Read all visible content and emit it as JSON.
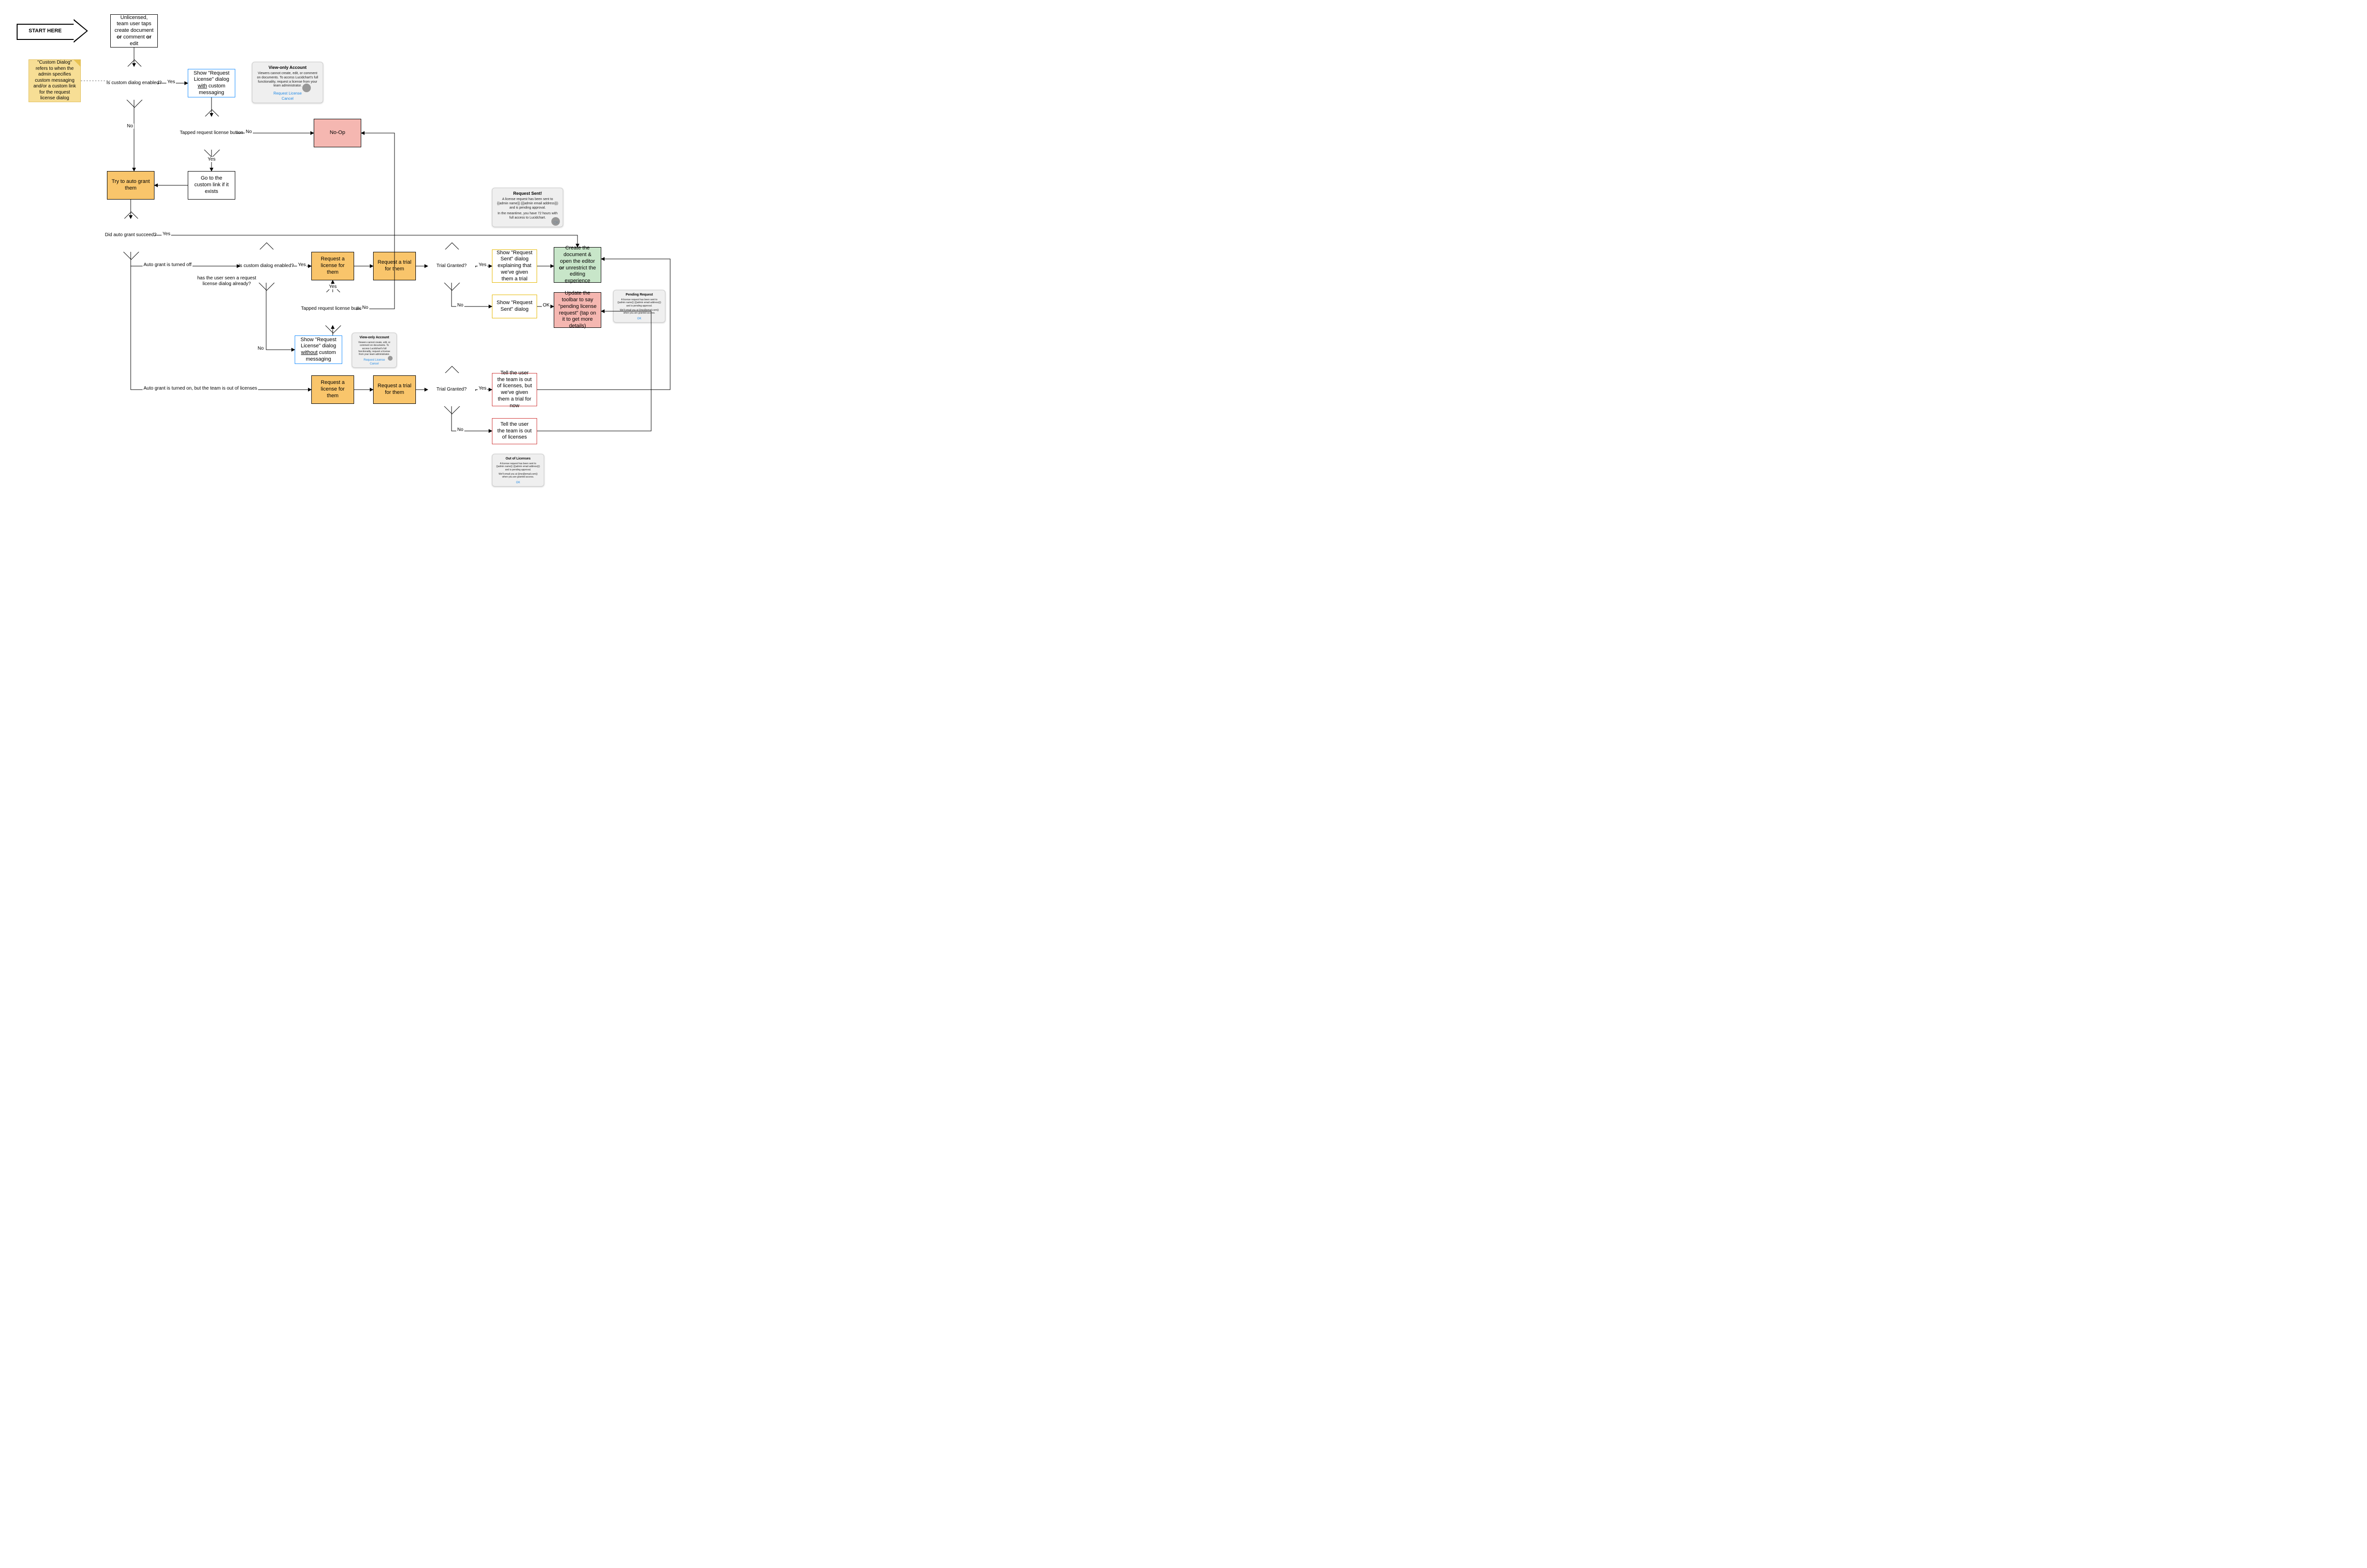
{
  "start_arrow": "START HERE",
  "sticky": "\"Custom Dialog\" refers to when the admin specifies custom messaging and/or a custom link for the request license dialog",
  "nodes": {
    "start": [
      "Unlicensed, team user taps create document ",
      {
        "b": "or"
      },
      " comment ",
      {
        "b": "or"
      },
      " edit"
    ],
    "custom1": "Is custom dialog enabled?",
    "showWith": [
      "Show \"Request License\" dialog ",
      {
        "u": "with"
      },
      " custom messaging"
    ],
    "tapped1": "Tapped request license button",
    "noop": "No-Op",
    "goCustom": "Go to the custom link if it exists",
    "autoGrant": "Try to auto grant them",
    "didSucceed": "Did auto grant succeed?",
    "custom2": "Is custom dialog enabled?",
    "seenAlready": "has the user seen a request license dialog already?",
    "reqLic1": "Request a license for them",
    "reqTrial1": "Request a trial for them",
    "trial1": "Trial Granted?",
    "sentTrial": "Show \"Request Sent\" dialog explaining that we've given them a trial",
    "sentPlain": "Show \"Request Sent\" dialog",
    "createDoc": [
      "Create the document & open the editor ",
      {
        "b": "or"
      },
      " unrestrict the editing experience"
    ],
    "updateToolbar": "Update the toolbar to say \"pending license request\" (tap on it to get more details)",
    "tapped2": "Tapped request license button",
    "showWithout": [
      "Show \"Request License\" dialog ",
      {
        "u": "without"
      },
      " custom messaging"
    ],
    "reqLic2": "Request a license for them",
    "reqTrial2": "Request a trial for them",
    "trial2": "Trial Granted?",
    "outTrial": "Tell the user the team is out of licenses, but we've given them a trial for now",
    "outPlain": "Tell the user the team is out of licenses"
  },
  "edge_labels": {
    "yes": "Yes",
    "no": "No",
    "ok": "OK",
    "autoOff": "Auto grant is turned off",
    "autoOnOut": "Auto grant is turned on, but the team is out of licenses"
  },
  "dialogs": {
    "viewOnly": {
      "title": "View-only Account",
      "body": "Viewers cannot create, edit, or comment on documents. To access Lucidchart's full functionality, request a license from your team administrator.",
      "primary": "Request License",
      "secondary": "Cancel"
    },
    "requestSent": {
      "title": "Request Sent!",
      "body1": "A license request has been sent to {{admin name}} ({{admin email address}}) and is pending approval.",
      "body2": "In the meantime, you have 72 hours with full access to Lucidchart.",
      "ok": "OK"
    },
    "pending": {
      "title": "Pending Request",
      "body1": "A license request has been sent to {{admin name}} ({{admin email address}}) and is pending approval.",
      "body2": "We'll email you at {{me@email.com}} when you are granted access.",
      "ok": "OK"
    },
    "outOfLicenses": {
      "title": "Out of Licenses",
      "body1": "A license request has been sent to {{admin name}} ({{admin email address}}) and is pending approval.",
      "body2": "We'll email you at {{me@email.com}} when you are granted access.",
      "ok": "OK"
    }
  },
  "chart_data": {
    "type": "flowchart",
    "nodes": [
      {
        "id": "start",
        "kind": "process",
        "text": "Unlicensed, team user taps create document or comment or edit"
      },
      {
        "id": "custom1",
        "kind": "decision",
        "text": "Is custom dialog enabled?"
      },
      {
        "id": "showWith",
        "kind": "process",
        "text": "Show \"Request License\" dialog with custom messaging",
        "style": "cyan"
      },
      {
        "id": "tapped1",
        "kind": "decision",
        "text": "Tapped request license button"
      },
      {
        "id": "noop",
        "kind": "process",
        "text": "No-Op",
        "style": "pink"
      },
      {
        "id": "goCustom",
        "kind": "process",
        "text": "Go to the custom link if it exists"
      },
      {
        "id": "autoGrant",
        "kind": "process",
        "text": "Try to auto grant them",
        "style": "orange"
      },
      {
        "id": "didSucceed",
        "kind": "decision",
        "text": "Did auto grant succeed?"
      },
      {
        "id": "custom2",
        "kind": "decision",
        "text": "Is custom dialog enabled?"
      },
      {
        "id": "seenAlready",
        "kind": "annotation",
        "text": "has the user seen a request license dialog already?"
      },
      {
        "id": "reqLic1",
        "kind": "process",
        "text": "Request a license for them",
        "style": "orange"
      },
      {
        "id": "reqTrial1",
        "kind": "process",
        "text": "Request a trial for them",
        "style": "orange"
      },
      {
        "id": "trial1",
        "kind": "decision",
        "text": "Trial Granted?"
      },
      {
        "id": "sentTrial",
        "kind": "process",
        "text": "Show \"Request Sent\" dialog explaining that we've given them a trial",
        "style": "yellow"
      },
      {
        "id": "sentPlain",
        "kind": "process",
        "text": "Show \"Request Sent\" dialog",
        "style": "yellow"
      },
      {
        "id": "createDoc",
        "kind": "process",
        "text": "Create the document & open the editor or unrestrict the editing experience",
        "style": "green"
      },
      {
        "id": "updateToolbar",
        "kind": "process",
        "text": "Update the toolbar to say \"pending license request\" (tap on it to get more details)",
        "style": "pink"
      },
      {
        "id": "tapped2",
        "kind": "decision",
        "text": "Tapped request license button"
      },
      {
        "id": "showWithout",
        "kind": "process",
        "text": "Show \"Request License\" dialog without custom messaging",
        "style": "cyan"
      },
      {
        "id": "reqLic2",
        "kind": "process",
        "text": "Request a license for them",
        "style": "orange"
      },
      {
        "id": "reqTrial2",
        "kind": "process",
        "text": "Request a trial for them",
        "style": "orange"
      },
      {
        "id": "trial2",
        "kind": "decision",
        "text": "Trial Granted?"
      },
      {
        "id": "outTrial",
        "kind": "process",
        "text": "Tell the user the team is out of licenses, but we've given them a trial for now",
        "style": "red"
      },
      {
        "id": "outPlain",
        "kind": "process",
        "text": "Tell the user the team is out of licenses",
        "style": "red"
      }
    ],
    "edges": [
      {
        "from": "start",
        "to": "custom1"
      },
      {
        "from": "custom1",
        "to": "showWith",
        "label": "Yes"
      },
      {
        "from": "custom1",
        "to": "autoGrant",
        "label": "No"
      },
      {
        "from": "showWith",
        "to": "tapped1"
      },
      {
        "from": "tapped1",
        "to": "noop",
        "label": "No"
      },
      {
        "from": "tapped1",
        "to": "goCustom",
        "label": "Yes"
      },
      {
        "from": "goCustom",
        "to": "autoGrant"
      },
      {
        "from": "autoGrant",
        "to": "didSucceed"
      },
      {
        "from": "didSucceed",
        "to": "createDoc",
        "label": "Yes"
      },
      {
        "from": "didSucceed",
        "to": "custom2",
        "label": "Auto grant is turned off"
      },
      {
        "from": "didSucceed",
        "to": "reqLic2",
        "label": "Auto grant is turned on, but the team is out of licenses"
      },
      {
        "from": "custom2",
        "to": "reqLic1",
        "label": "Yes"
      },
      {
        "from": "custom2",
        "to": "showWithout",
        "label": "No"
      },
      {
        "from": "showWithout",
        "to": "tapped2"
      },
      {
        "from": "tapped2",
        "to": "reqLic1",
        "label": "Yes"
      },
      {
        "from": "tapped2",
        "to": "noop",
        "label": "No"
      },
      {
        "from": "reqLic1",
        "to": "reqTrial1"
      },
      {
        "from": "reqTrial1",
        "to": "trial1"
      },
      {
        "from": "trial1",
        "to": "sentTrial",
        "label": "Yes"
      },
      {
        "from": "trial1",
        "to": "sentPlain",
        "label": "No"
      },
      {
        "from": "sentTrial",
        "to": "createDoc"
      },
      {
        "from": "sentPlain",
        "to": "updateToolbar",
        "label": "OK"
      },
      {
        "from": "reqLic2",
        "to": "reqTrial2"
      },
      {
        "from": "reqTrial2",
        "to": "trial2"
      },
      {
        "from": "trial2",
        "to": "outTrial",
        "label": "Yes"
      },
      {
        "from": "trial2",
        "to": "outPlain",
        "label": "No"
      },
      {
        "from": "outTrial",
        "to": "createDoc"
      },
      {
        "from": "outPlain",
        "to": "updateToolbar"
      }
    ],
    "annotations": [
      {
        "text": "\"Custom Dialog\" refers to when the admin specifies custom messaging and/or a custom link for the request license dialog",
        "kind": "sticky-note"
      },
      {
        "text": "START HERE",
        "kind": "arrow-callout"
      }
    ],
    "mocks": [
      "View-only Account dialog (2x)",
      "Request Sent! dialog",
      "Pending Request dialog",
      "Out of Licenses dialog"
    ]
  }
}
